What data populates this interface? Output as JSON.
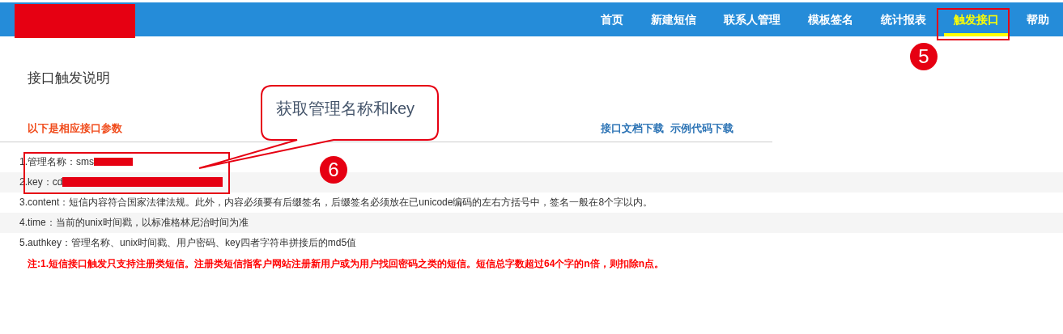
{
  "nav": {
    "items": [
      {
        "label": "首页",
        "selected": false
      },
      {
        "label": "新建短信",
        "selected": false
      },
      {
        "label": "联系人管理",
        "selected": false
      },
      {
        "label": "模板签名",
        "selected": false
      },
      {
        "label": "统计报表",
        "selected": false
      },
      {
        "label": "触发接口",
        "selected": true
      },
      {
        "label": "帮助",
        "selected": false
      }
    ]
  },
  "page_title": "接口触发说明",
  "section_heading": "以下是相应接口参数",
  "links": [
    "接口文档下载",
    "示例代码下载"
  ],
  "params": [
    {
      "text": "1.管理名称：sms",
      "redacted": true
    },
    {
      "text": "2.key：cd",
      "redacted": true
    },
    {
      "text": "3.content：短信内容符合国家法律法规。此外，内容必须要有后缀签名，后缀签名必须放在已unicode编码的左右方括号中，签名一般在8个字以内。",
      "redacted": false
    },
    {
      "text": "4.time：当前的unix时间戳，以标准格林尼治时间为准",
      "redacted": false
    },
    {
      "text": "5.authkey：管理名称、unix时间戳、用户密码、key四者字符串拼接后的md5值",
      "redacted": false
    }
  ],
  "note": "注:1.短信接口触发只支持注册类短信。注册类短信指客户网站注册新用户或为用户找回密码之类的短信。短信总字数超过64个字的n倍，则扣除n点。",
  "annotations": {
    "callout": "获取管理名称和key",
    "steps": [
      "5",
      "6"
    ]
  }
}
